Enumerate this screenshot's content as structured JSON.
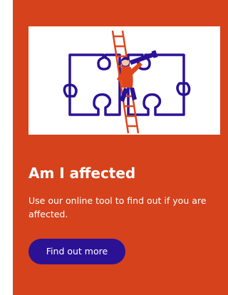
{
  "card": {
    "title": "Am I affected",
    "description": "Use our online tool to find out if you are affected.",
    "cta_label": "Find out more",
    "illustration_icon": "puzzle-ladder-telescope-illustration"
  },
  "colors": {
    "card_background": "#d6421c",
    "button_background": "#2b1295",
    "text": "#ffffff",
    "puzzle_outline": "#2b1295",
    "ladder": "#e0461c"
  }
}
